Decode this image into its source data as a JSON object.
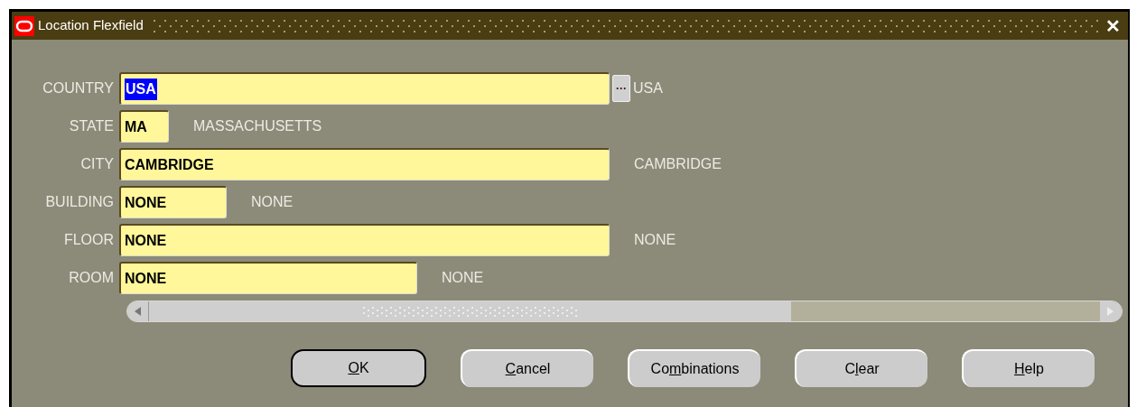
{
  "window": {
    "title": "Location Flexfield",
    "close": "✕"
  },
  "fields": [
    {
      "label": "COUNTRY",
      "value": "USA",
      "text_selected": true,
      "lov": "···",
      "description": "USA"
    },
    {
      "label": "STATE",
      "value": "MA",
      "text_selected": false,
      "description": "MASSACHUSETTS"
    },
    {
      "label": "CITY",
      "value": "CAMBRIDGE",
      "text_selected": false,
      "description": "CAMBRIDGE"
    },
    {
      "label": "BUILDING",
      "value": "NONE",
      "text_selected": false,
      "description": "NONE"
    },
    {
      "label": "FLOOR",
      "value": "NONE",
      "text_selected": false,
      "description": "NONE"
    },
    {
      "label": "ROOM",
      "value": "NONE",
      "text_selected": false,
      "description": "NONE"
    }
  ],
  "buttons": [
    {
      "label": "OK",
      "default": true
    },
    {
      "label": "Cancel",
      "default": false
    },
    {
      "label": "Combinations",
      "default": false
    },
    {
      "label": "Clear",
      "default": false
    },
    {
      "label": "Help",
      "default": false
    }
  ]
}
